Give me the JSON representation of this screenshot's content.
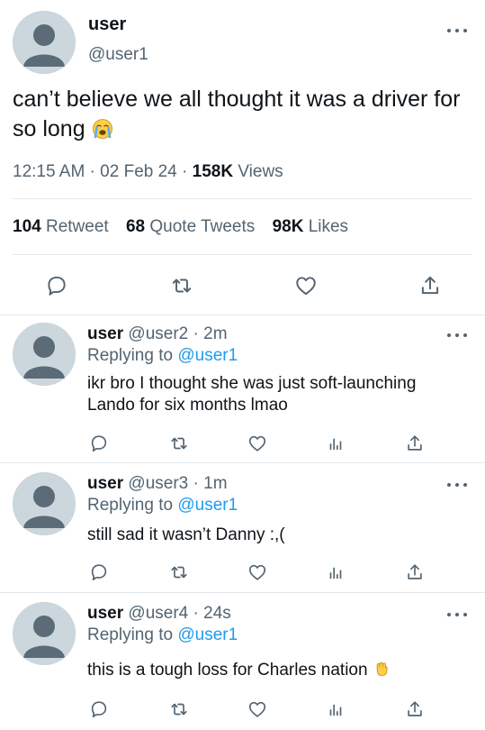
{
  "main": {
    "display_name": "user",
    "handle": "@user1",
    "text": "can’t believe we all thought it was a driver for so long",
    "emoji": "loudly-crying-face",
    "time": "12:15 AM",
    "date": "02 Feb 24",
    "views_count": "158K",
    "views_label": "Views",
    "retweets_count": "104",
    "retweets_label": "Retweet",
    "quotes_count": "68",
    "quotes_label": "Quote Tweets",
    "likes_count": "98K",
    "likes_label": "Likes"
  },
  "replies": [
    {
      "display_name": "user",
      "handle": "@user2",
      "time": "2m",
      "replying_prefix": "Replying to",
      "replying_to": "@user1",
      "text": "ikr bro I thought she was just soft-launching Lando for six months lmao"
    },
    {
      "display_name": "user",
      "handle": "@user3",
      "time": "1m",
      "replying_prefix": "Replying to",
      "replying_to": "@user1",
      "text": "still sad it wasn’t Danny :,("
    },
    {
      "display_name": "user",
      "handle": "@user4",
      "time": "24s",
      "replying_prefix": "Replying to",
      "replying_to": "@user1",
      "text": "this is a tough loss for Charles nation",
      "emoji": "raised-fist"
    }
  ],
  "colors": {
    "text": "#0f1419",
    "secondary": "#536471",
    "link": "#1d9bf0",
    "avatar_bg": "#ccd6dd",
    "avatar_fg": "#5b6b77",
    "divider": "#e1e8ed"
  },
  "icons": [
    "reply-icon",
    "retweet-icon",
    "like-icon",
    "share-icon",
    "analytics-icon",
    "more-icon"
  ]
}
